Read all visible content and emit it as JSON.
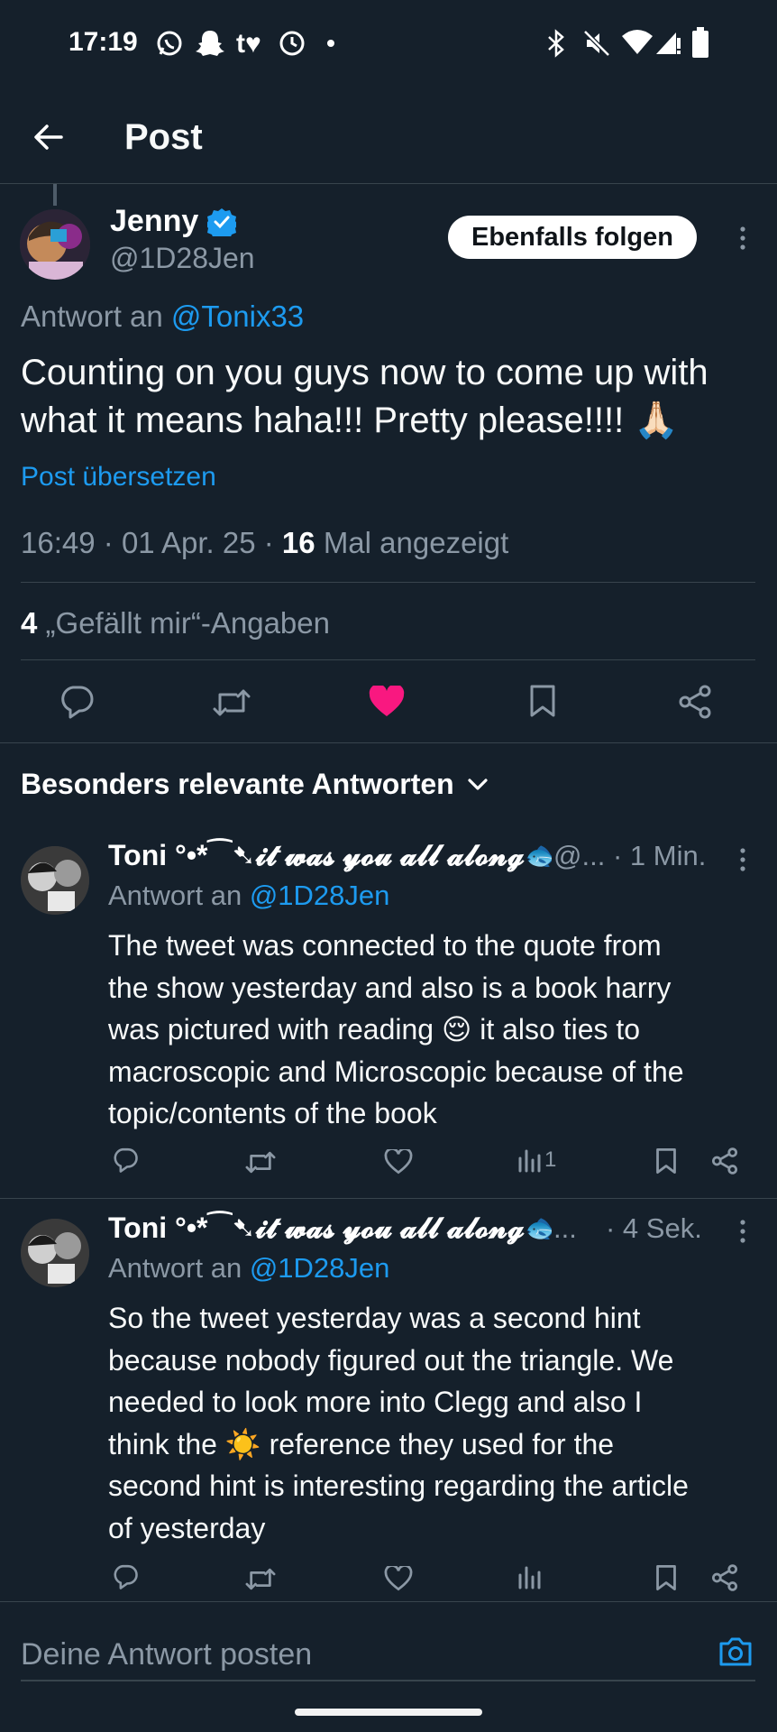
{
  "status_bar": {
    "time": "17:19",
    "left_icons": [
      "whatsapp-icon",
      "snapchat-icon",
      "tumblr-icon",
      "clock-icon",
      "dot-icon"
    ],
    "right_icons": [
      "bluetooth-icon",
      "mute-icon",
      "wifi-icon",
      "signal-icon",
      "battery-icon"
    ]
  },
  "header": {
    "title": "Post",
    "back_icon": "arrow-left-icon"
  },
  "main_tweet": {
    "author_name": "Jenny",
    "author_handle": "@1D28Jen",
    "verified": true,
    "follow_label": "Ebenfalls folgen",
    "reply_prefix": "Antwort an",
    "reply_to": "@Tonix33",
    "text_line1": "Counting on you guys now to come up with",
    "text_line2": "what it means haha!!! Pretty please!!!! 🙏🏻",
    "translate": "Post übersetzen",
    "time": "16:49",
    "sep": "·",
    "date": "01 Apr. 25",
    "views_count": "16",
    "views_label": "Mal angezeigt",
    "likes_count": "4",
    "likes_label": "„Gefällt mir“-Angaben",
    "liked": true
  },
  "replies_header": "Besonders relevante Antworten",
  "replies": [
    {
      "name": "Toni °•*⁀➷𝓲𝓽 𝔀𝓪𝓼 𝔂𝓸𝓾 𝓪𝓵𝓵 𝓪𝓵𝓸𝓷𝓰🐟",
      "handle": "@...",
      "time": "· 1 Min.",
      "reply_prefix": "Antwort an",
      "reply_to": "@1D28Jen",
      "lines": [
        "The tweet was connected to the quote from",
        "the show yesterday and also is a book harry",
        "was pictured with reading 😌 it also ties to",
        "macroscopic and Microscopic because of the",
        "topic/contents of the book"
      ],
      "views": "1"
    },
    {
      "name": "Toni °•*⁀➷𝓲𝓽 𝔀𝓪𝓼 𝔂𝓸𝓾 𝓪𝓵𝓵 𝓪𝓵𝓸𝓷𝓰🐟",
      "handle": "...",
      "time": "· 4 Sek.",
      "reply_prefix": "Antwort an",
      "reply_to": "@1D28Jen",
      "lines": [
        "So the tweet yesterday was a second hint",
        "because nobody figured out the triangle. We",
        "needed to look more into Clegg and also I",
        "think the ☀️ reference they used for the",
        "second hint is interesting regarding the article",
        "of yesterday"
      ],
      "views": ""
    }
  ],
  "composer": {
    "placeholder": "Deine Antwort posten",
    "camera_icon": "camera-icon"
  },
  "colors": {
    "background": "#15202b",
    "accent": "#1d9bf0",
    "like": "#f91880",
    "muted": "#8b98a5",
    "divider": "#38444d"
  }
}
